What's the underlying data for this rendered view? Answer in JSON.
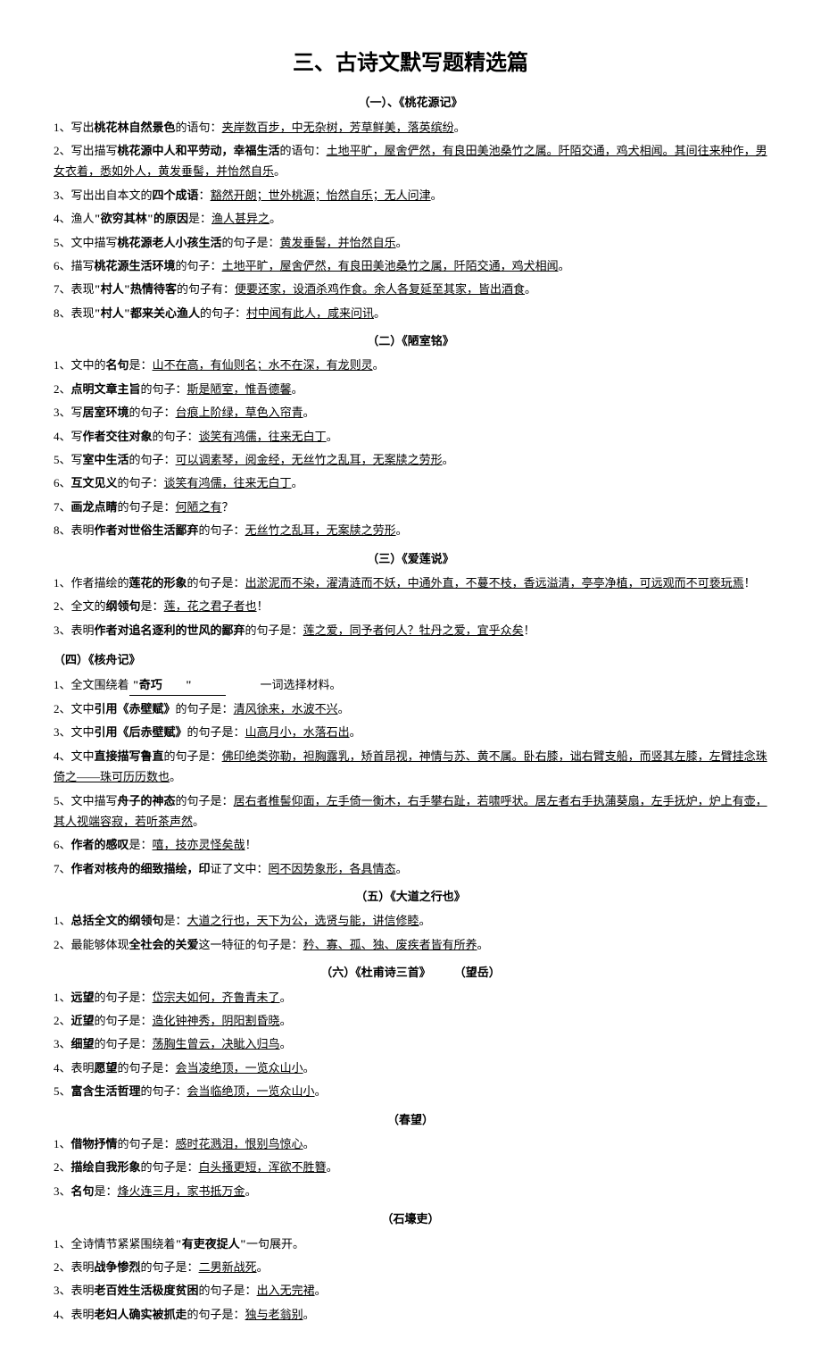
{
  "title": "三、古诗文默写题精选篇",
  "sections": [
    {
      "heading": "（一）、《桃花源记》",
      "items": [
        {
          "num": "1、",
          "pre": "写出",
          "b": "桃花林自然景色",
          "mid": "的语句：",
          "ans": "夹岸数百步，中无杂树，芳草鲜美，落英缤纷",
          "post": "。"
        },
        {
          "num": "2、",
          "pre": "写出描写",
          "b": "桃花源中人和平劳动，幸福生活",
          "mid": "的语句：",
          "ans": "土地平旷，屋舍俨然，有良田美池桑竹之属。阡陌交通，鸡犬相闻。其间往来种作，男女衣着，悉如外人，黄发垂髻，并怡然自乐",
          "post": "。"
        },
        {
          "num": "3、",
          "pre": "写出出自本文的",
          "b": "四个成语",
          "mid": "：",
          "ans": "豁然开朗；世外桃源；怡然自乐；无人问津",
          "post": "。"
        },
        {
          "num": "4、",
          "pre": "渔人",
          "b": "\"欲穷其林\"的原因",
          "mid": "是：",
          "ans": "渔人甚异之",
          "post": "。"
        },
        {
          "num": "5、",
          "pre": "文中描写",
          "b": "桃花源老人小孩生活",
          "mid": "的句子是：",
          "ans": "黄发垂髻，并怡然自乐",
          "post": "。"
        },
        {
          "num": "6、",
          "pre": "描写",
          "b": "桃花源生活环境",
          "mid": "的句子：",
          "ans": "土地平旷，屋舍俨然，有良田美池桑竹之属，阡陌交通，鸡犬相闻",
          "post": "。"
        },
        {
          "num": "7、",
          "pre": "表现",
          "b": "\"村人\"热情待客",
          "mid": "的句子有：",
          "ans": "便要还家，设酒杀鸡作食。余人各复延至其家，皆出酒食",
          "post": "。"
        },
        {
          "num": "8、",
          "pre": "表现",
          "b": "\"村人\"都来关心渔人",
          "mid": "的句子：",
          "ans": "村中闻有此人，咸来问讯",
          "post": "。"
        }
      ]
    },
    {
      "heading": "（二）《陋室铭》",
      "items": [
        {
          "num": "1、",
          "pre": "文中的",
          "b": "名句",
          "mid": "是：",
          "ans": "山不在高，有仙则名；水不在深，有龙则灵",
          "post": "。"
        },
        {
          "num": "2、",
          "pre": "",
          "b": "点明文章主旨",
          "mid": "的句子：",
          "ans": "斯是陋室，惟吾德馨",
          "post": "。"
        },
        {
          "num": "3、",
          "pre": "写",
          "b": "居室环境",
          "mid": "的句子：",
          "ans": "台痕上阶绿，草色入帘青",
          "post": "。"
        },
        {
          "num": "4、",
          "pre": "写",
          "b": "作者交往对象",
          "mid": "的句子：",
          "ans": "谈笑有鸿儒，往来无白丁",
          "post": "。"
        },
        {
          "num": "5、",
          "pre": "写",
          "b": "室中生活",
          "mid": "的句子：",
          "ans": "可以调素琴，阅金经，无丝竹之乱耳，无案牍之劳形",
          "post": "。"
        },
        {
          "num": "6、",
          "pre": "",
          "b": "互文见义",
          "mid": "的句子：",
          "ans": "谈笑有鸿儒，往来无白丁",
          "post": "。"
        },
        {
          "num": "7、",
          "pre": "",
          "b": "画龙点睛",
          "mid": "的句子是：",
          "ans": "何陋之有",
          "post": "？"
        },
        {
          "num": "8、",
          "pre": "表明",
          "b": "作者对世俗生活鄙弃",
          "mid": "的句子：",
          "ans": "无丝竹之乱耳，无案牍之劳形",
          "post": "。"
        }
      ]
    },
    {
      "heading": "（三）《爱莲说》",
      "items": [
        {
          "num": "1、",
          "pre": "作者描绘的",
          "b": "莲花的形象",
          "mid": "的句子是：",
          "ans": "出淤泥而不染，濯清涟而不妖，中通外直，不蔓不枝，香远溢清，亭亭净植，可远观而不可亵玩焉",
          "post": "！"
        },
        {
          "num": "2、",
          "pre": "全文的",
          "b": "纲领句",
          "mid": "是：",
          "ans": "莲，花之君子者也",
          "post": "！"
        },
        {
          "num": "3、",
          "pre": "表明",
          "b": "作者对追名逐利的世风的鄙弃",
          "mid": "的句子是：",
          "ans": "莲之爱，同予者何人？牡丹之爱，宜乎众矣",
          "post": "！"
        }
      ]
    },
    {
      "heading": "（四）《核舟记》",
      "left": true,
      "items": [
        {
          "num": "1、",
          "raw": "全文围绕着",
          "fill": "\"奇巧　　\"",
          "rawpost": "　　　一词选择材料。"
        },
        {
          "num": "2、",
          "pre": "文中",
          "b": "引用《赤壁赋》",
          "mid": "的句子是：",
          "ans": "清风徐来，水波不兴",
          "post": "。"
        },
        {
          "num": "3、",
          "pre": "文中",
          "b": "引用《后赤壁赋》",
          "mid": "的句子是：",
          "ans": "山高月小，水落石出",
          "post": "。"
        },
        {
          "num": "4、",
          "pre": "文中",
          "b": "直接描写鲁直",
          "mid": "的句子是：",
          "ans": "佛印绝类弥勒，袒胸露乳，矫首昂视，神情与苏、黄不属。卧右膝，诎右臂支船，而竖其左膝，左臂挂念珠倚之——珠可历历数也",
          "post": "。"
        },
        {
          "num": "5、",
          "pre": "文中描写",
          "b": "舟子的神态",
          "mid": "的句子是：",
          "ans": "居右者椎髻仰面，左手倚一衡木，右手攀右趾，若啸呼状。居左者右手执蒲葵扇，左手抚炉，炉上有壶，其人视端容寂，若听茶声然",
          "post": "。"
        },
        {
          "num": "6、",
          "pre": "",
          "b": "作者的感叹",
          "mid": "是：",
          "ans": "嘻，技亦灵怪矣哉",
          "post": "！"
        },
        {
          "num": "7、",
          "pre": "",
          "b": "作者对核舟的细致描绘，印",
          "mid": "证了文中：",
          "ans": "罔不因势象形，各具情态",
          "post": "。"
        }
      ]
    },
    {
      "heading": "（五）《大道之行也》",
      "items": [
        {
          "num": "1、",
          "pre": "",
          "b": "总括全文的纲领句",
          "mid": "是：",
          "ans": "大道之行也，天下为公，选贤与能，讲信修睦",
          "post": "。"
        },
        {
          "num": "2、",
          "pre": "最能够体现",
          "b": "全社会的关爱",
          "mid": "这一特征的句子是：",
          "ans": "矜、寡、孤、独、废疾者皆有所养",
          "post": "。"
        }
      ]
    },
    {
      "heading": "（六）《杜甫诗三首》　　　（望岳）",
      "items": [
        {
          "num": "1、",
          "pre": "",
          "b": "远望",
          "mid": "的句子是：",
          "ans": "岱宗夫如何，齐鲁青未了",
          "post": "。"
        },
        {
          "num": "2、",
          "pre": "",
          "b": "近望",
          "mid": "的句子是：",
          "ans": "造化钟神秀，阴阳割昏晓",
          "post": "。"
        },
        {
          "num": "3、",
          "pre": "",
          "b": "细望",
          "mid": "的句子是：",
          "ans": "荡胸生曾云，决眦入归鸟",
          "post": "。"
        },
        {
          "num": "4、",
          "pre": "表明",
          "b": "愿望",
          "mid": "的句子是：",
          "ans": "会当凌绝顶，一览众山小",
          "post": "。"
        },
        {
          "num": "5、",
          "pre": "",
          "b": "富含生活哲理",
          "mid": "的句子：",
          "ans": "会当临绝顶，一览众山小",
          "post": "。"
        }
      ]
    },
    {
      "heading": "（春望）",
      "items": [
        {
          "num": "1、",
          "pre": "",
          "b": "借物抒情",
          "mid": "的句子是：",
          "ans": "感时花溅泪，恨别鸟惊心",
          "post": "。"
        },
        {
          "num": "2、",
          "pre": "",
          "b": "描绘自我形象",
          "mid": "的句子是：",
          "ans": "白头搔更短，浑欲不胜簪",
          "post": "。"
        },
        {
          "num": "3、",
          "pre": "",
          "b": "名句",
          "mid": "是：",
          "ans": "烽火连三月，家书抵万金",
          "post": "。"
        }
      ]
    },
    {
      "heading": "（石壕吏）",
      "items": [
        {
          "num": "1、",
          "raw": "全诗情节紧紧围绕着",
          "b": "\"有吏夜捉人\"",
          "rawpost": "一句展开。"
        },
        {
          "num": "2、",
          "pre": "表明",
          "b": "战争惨烈",
          "mid": "的句子是：",
          "ans": "二男新战死",
          "post": "。"
        },
        {
          "num": "3、",
          "pre": "表明",
          "b": "老百姓生活极度贫困",
          "mid": "的句子是：",
          "ans": "出入无完裙",
          "post": "。"
        },
        {
          "num": "4、",
          "pre": "表明",
          "b": "老妇人确实被抓走",
          "mid": "的句子是：",
          "ans": "独与老翁别",
          "post": "。"
        }
      ]
    }
  ]
}
